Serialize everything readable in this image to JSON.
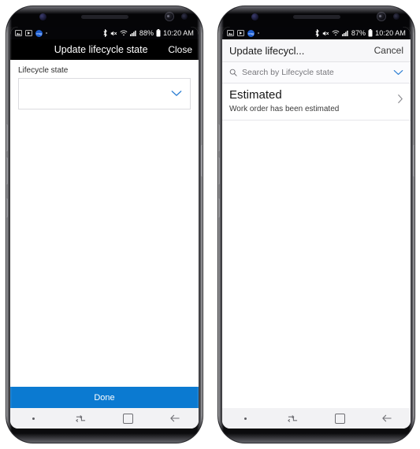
{
  "phones": [
    {
      "id": "left",
      "status_bar": {
        "icons": [
          "image-icon",
          "play-icon",
          "app-badge-icon",
          "dot-icon"
        ],
        "app_badge_text": "msg",
        "right_icons": [
          "bluetooth-icon",
          "mute-icon",
          "wifi-icon",
          "signal-icon",
          "battery-icon"
        ],
        "battery": "88%",
        "time": "10:20 AM"
      },
      "header": {
        "title": "Update lifecycle state",
        "action": "Close"
      },
      "form": {
        "field_label": "Lifecycle state",
        "dropdown_value": "",
        "dropdown_icon": "chevron-down-icon"
      },
      "footer": {
        "done_label": "Done"
      },
      "nav": {
        "items": [
          "dot-indicator",
          "recents-icon",
          "home-icon",
          "back-icon"
        ]
      }
    },
    {
      "id": "right",
      "status_bar": {
        "icons": [
          "image-icon",
          "play-icon",
          "app-badge-icon",
          "dot-icon"
        ],
        "app_badge_text": "msg",
        "right_icons": [
          "bluetooth-icon",
          "mute-icon",
          "wifi-icon",
          "signal-icon",
          "battery-icon"
        ],
        "battery": "87%",
        "time": "10:20 AM"
      },
      "header": {
        "title": "Update lifecycl...",
        "action": "Cancel"
      },
      "search": {
        "placeholder": "Search by Lifecycle state",
        "search_icon": "search-icon",
        "chevron_icon": "chevron-down-icon"
      },
      "list": [
        {
          "title": "Estimated",
          "subtitle": "Work order has been estimated",
          "chevron": "chevron-right-icon"
        }
      ],
      "nav": {
        "items": [
          "dot-indicator",
          "recents-icon",
          "home-icon",
          "back-icon"
        ]
      }
    }
  ],
  "colors": {
    "accent_blue": "#0b7ad1",
    "link_blue": "#2d7fd3",
    "header_dark": "#000000",
    "header_light": "#f7f7f9",
    "nav_bg": "#f2f2f4"
  }
}
